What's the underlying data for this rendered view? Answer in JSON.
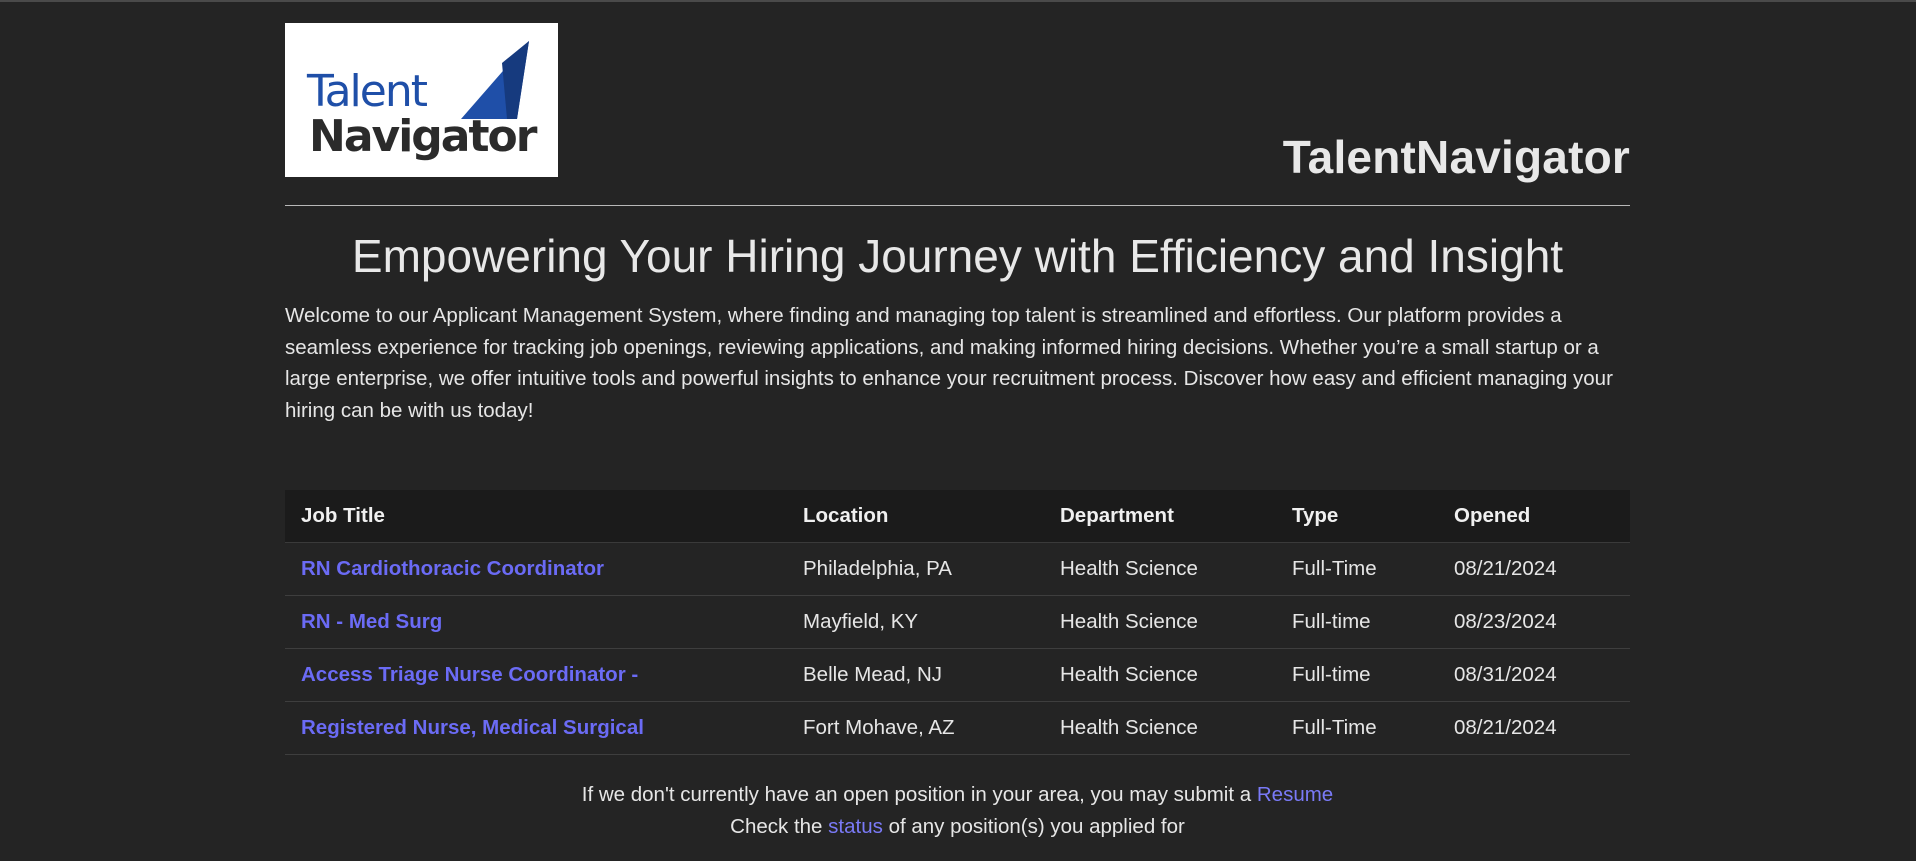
{
  "logo": {
    "line1": "Talent",
    "line2": "Navigator",
    "accent_color": "#1f4fa8",
    "accent_color_dark": "#163a7e"
  },
  "site_title": "TalentNavigator",
  "headline": "Empowering Your Hiring Journey with Efficiency and Insight",
  "intro": "Welcome to our Applicant Management System, where finding and managing top talent is streamlined and effortless. Our platform provides a seamless experience for tracking job openings, reviewing applications, and making informed hiring decisions. Whether you’re a small startup or a large enterprise, we offer intuitive tools and powerful insights to enhance your recruitment process. Discover how easy and efficient managing your hiring can be with us today!",
  "table": {
    "headers": [
      "Job Title",
      "Location",
      "Department",
      "Type",
      "Opened"
    ],
    "rows": [
      {
        "title": "RN Cardiothoracic Coordinator",
        "location": "Philadelphia, PA",
        "department": "Health Science",
        "type": "Full-Time",
        "opened": "08/21/2024"
      },
      {
        "title": "RN - Med Surg",
        "location": "Mayfield, KY",
        "department": "Health Science",
        "type": "Full-time",
        "opened": "08/23/2024"
      },
      {
        "title": "Access Triage Nurse Coordinator -",
        "location": "Belle Mead, NJ",
        "department": "Health Science",
        "type": "Full-time",
        "opened": "08/31/2024"
      },
      {
        "title": "Registered Nurse, Medical Surgical",
        "location": "Fort Mohave, AZ",
        "department": "Health Science",
        "type": "Full-Time",
        "opened": "08/21/2024"
      }
    ]
  },
  "footer": {
    "line1_text": "If we don't currently have an open position in your area, you may submit a",
    "line1_link": "Resume",
    "line2_before": "Check the",
    "line2_link": "status",
    "line2_after": "of any position(s) you applied for"
  },
  "colors": {
    "background": "#242424",
    "link": "#6b6bf5",
    "table_header_bg": "#1b1b1b"
  }
}
